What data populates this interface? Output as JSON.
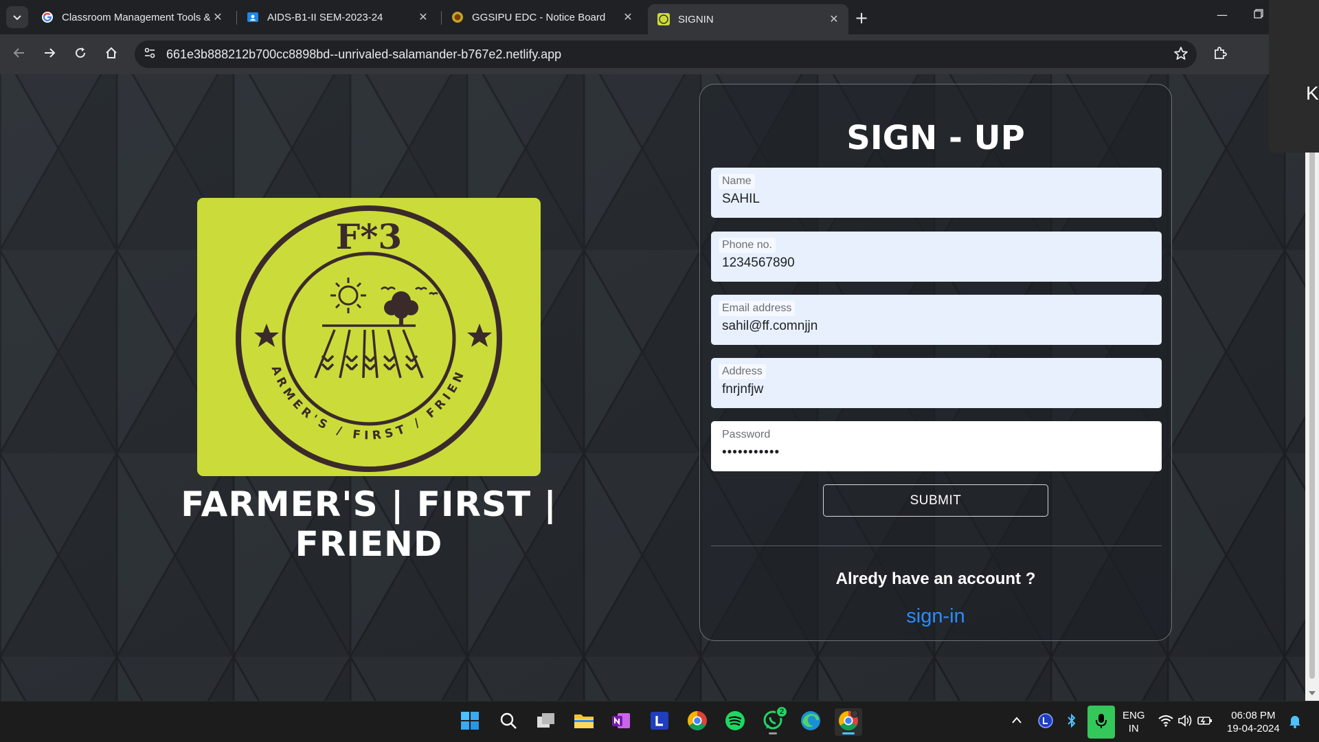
{
  "browser": {
    "tabs": [
      {
        "title": "Classroom Management Tools &",
        "icon": "google-icon",
        "active": false
      },
      {
        "title": "AIDS-B1-II SEM-2023-24",
        "icon": "google-classroom-icon",
        "active": false
      },
      {
        "title": "GGSIPU EDC - Notice Board",
        "icon": "ggsipu-icon",
        "active": false
      },
      {
        "title": "SIGNIN",
        "icon": "farmers-logo-icon",
        "active": true
      }
    ],
    "url": "661e3b888212b700cc8898bd--unrivaled-salamander-b767e2.netlify.app"
  },
  "side_popup": {
    "letter": "K"
  },
  "logo": {
    "monogram": "F*3",
    "ring_text": "FARMER'S / FIRST / FRIEND"
  },
  "tagline": "FARMER'S | FIRST | FRIEND",
  "form": {
    "title": "SIGN - UP",
    "fields": [
      {
        "label": "Name",
        "value": "SAHIL",
        "type": "text",
        "autofilled": true
      },
      {
        "label": "Phone no.",
        "value": "1234567890",
        "type": "text",
        "autofilled": true
      },
      {
        "label": "Email address",
        "value": "sahil@ff.comnjjn",
        "type": "text",
        "autofilled": true
      },
      {
        "label": "Address",
        "value": "fnrjnfjw",
        "type": "text",
        "autofilled": true
      },
      {
        "label": "Password",
        "value": "•••••••••••",
        "type": "password",
        "autofilled": false
      }
    ],
    "submit_label": "SUBMIT",
    "have_account_text": "Alredy have an account ?",
    "signin_link": "sign-in"
  },
  "colors": {
    "logo_bg": "#cbdc3a",
    "link": "#2b8cff",
    "autofill_bg": "#e8f0fe"
  },
  "taskbar": {
    "apps": [
      "windows-start-icon",
      "search-icon",
      "task-view-icon",
      "file-explorer-icon",
      "onenote-icon",
      "l-app-icon",
      "chrome-icon",
      "spotify-icon",
      "whatsapp-icon",
      "edge-icon",
      "chrome-profile-icon"
    ],
    "whatsapp_badge": "2",
    "lang_line1": "ENG",
    "lang_line2": "IN",
    "time": "06:08 PM",
    "date": "19-04-2024"
  }
}
